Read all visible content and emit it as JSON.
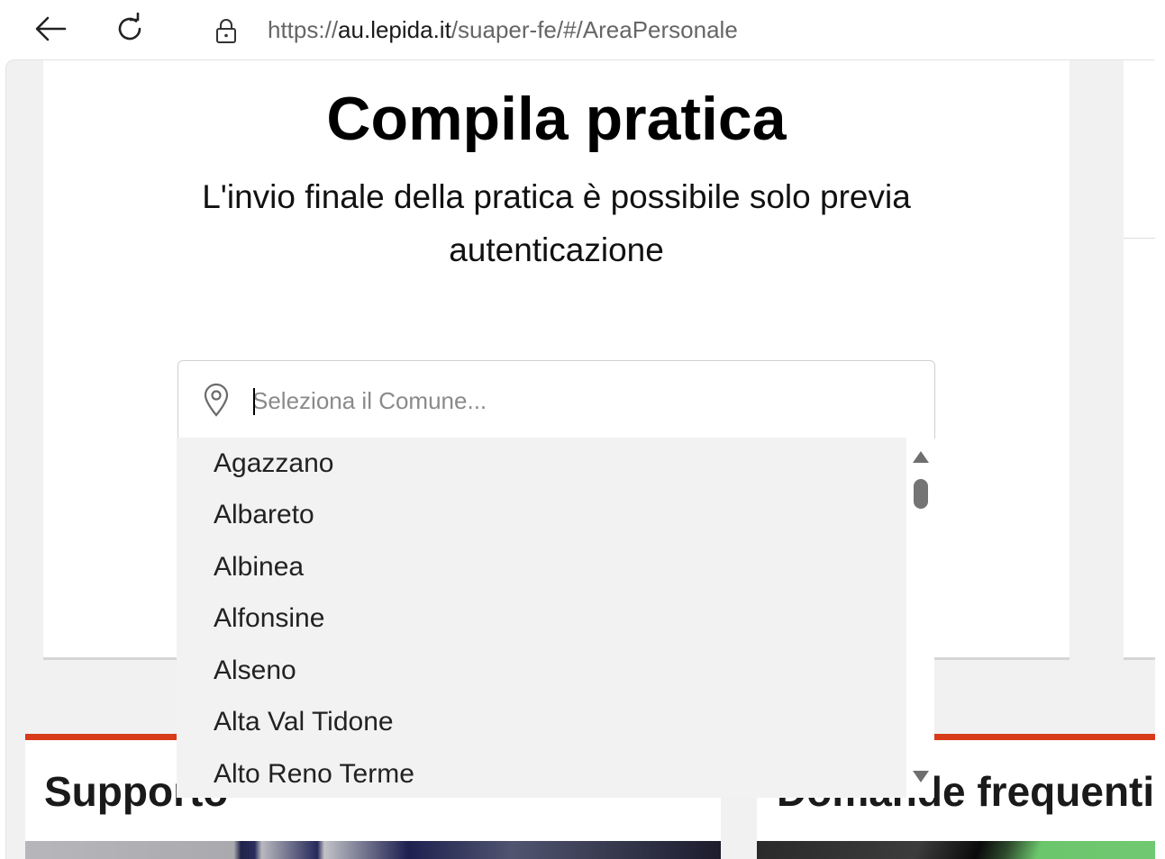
{
  "browser": {
    "url_scheme": "https://",
    "url_host": "au.lepida.it",
    "url_path": "/suaper-fe/#/AreaPersonale"
  },
  "main": {
    "title": "Compila pratica",
    "subtitle": "L'invio finale della pratica è possibile solo previa autenticazione"
  },
  "comune": {
    "placeholder": "Seleziona il Comune...",
    "options": [
      "Agazzano",
      "Albareto",
      "Albinea",
      "Alfonsine",
      "Alseno",
      "Alta Val Tidone",
      "Alto Reno Terme"
    ]
  },
  "sections": {
    "support_title": "Supporto",
    "faq_title": "Domande frequenti"
  },
  "colors": {
    "accent": "#d83b1a",
    "dropdown_bg": "#f2f2f2",
    "page_bg": "#f1f1f1"
  },
  "icons": {
    "back": "arrow-left-icon",
    "reload": "reload-icon",
    "lock": "lock-icon",
    "pin": "map-pin-icon"
  }
}
